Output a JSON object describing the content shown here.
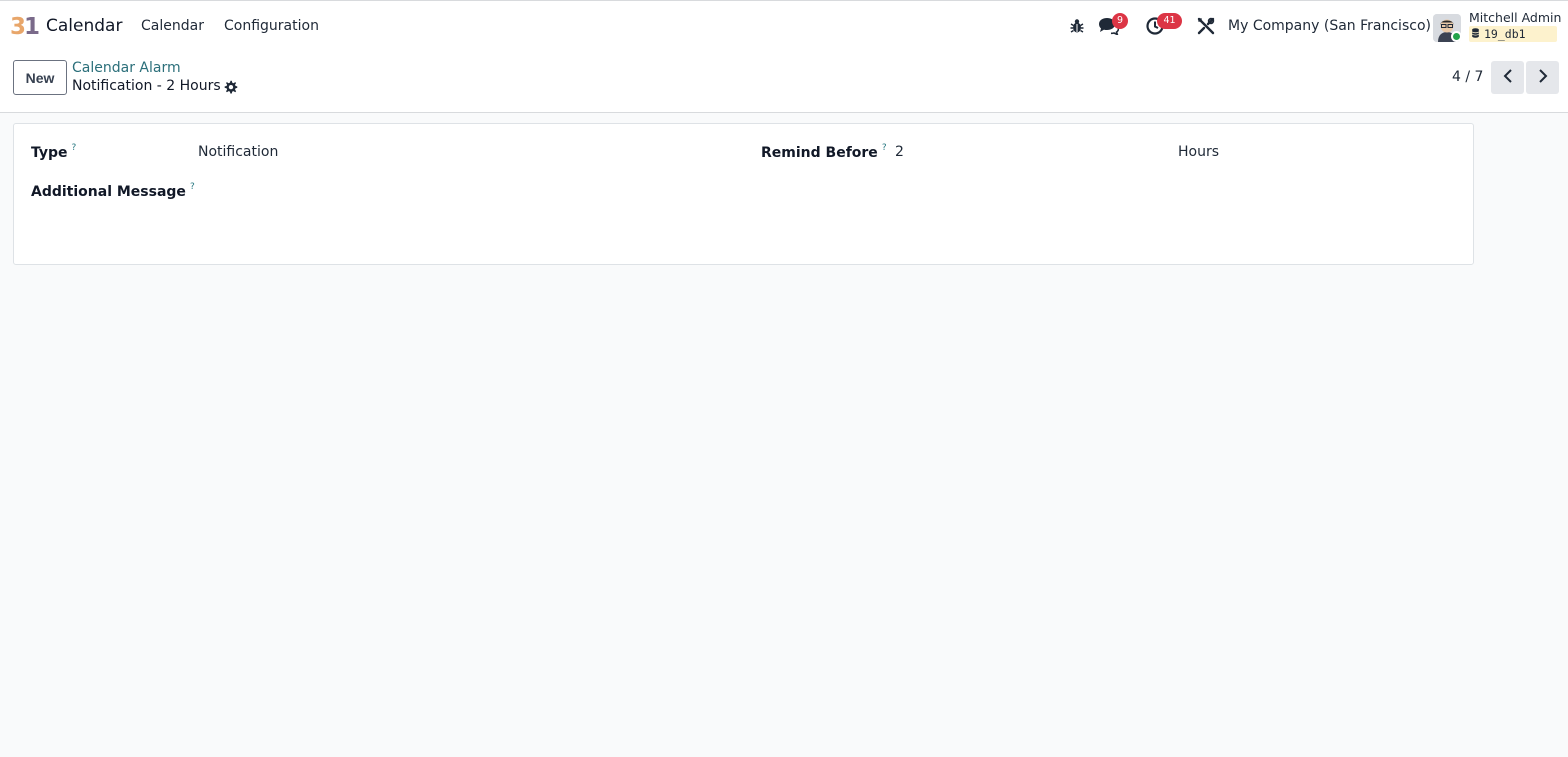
{
  "navbar": {
    "logo_digit_3": "3",
    "logo_digit_1": "1",
    "app_name": "Calendar",
    "menus": [
      {
        "label": "Calendar"
      },
      {
        "label": "Configuration"
      }
    ],
    "messages_badge": "9",
    "activities_badge": "41",
    "company": "My Company (San Francisco)",
    "user_name": "Mitchell Admin",
    "database": "19_db1"
  },
  "control_panel": {
    "new_label": "New",
    "breadcrumb": "Calendar Alarm",
    "record_title": "Notification - 2 Hours",
    "pager": "4 / 7"
  },
  "form": {
    "type_label": "Type",
    "type_value": "Notification",
    "remind_label": "Remind Before",
    "remind_value": "2",
    "remind_unit": "Hours",
    "message_label": "Additional Message",
    "help_mark": "?"
  },
  "colors": {
    "accent": "#2b6f7a",
    "badge": "#dc3545",
    "status_online": "#22a34a",
    "db_tag_bg": "#fdf2cd"
  },
  "icons": [
    "bug-icon",
    "chat-icon",
    "clock-icon",
    "tools-icon",
    "database-icon",
    "gear-icon",
    "chevron-left-icon",
    "chevron-right-icon"
  ]
}
